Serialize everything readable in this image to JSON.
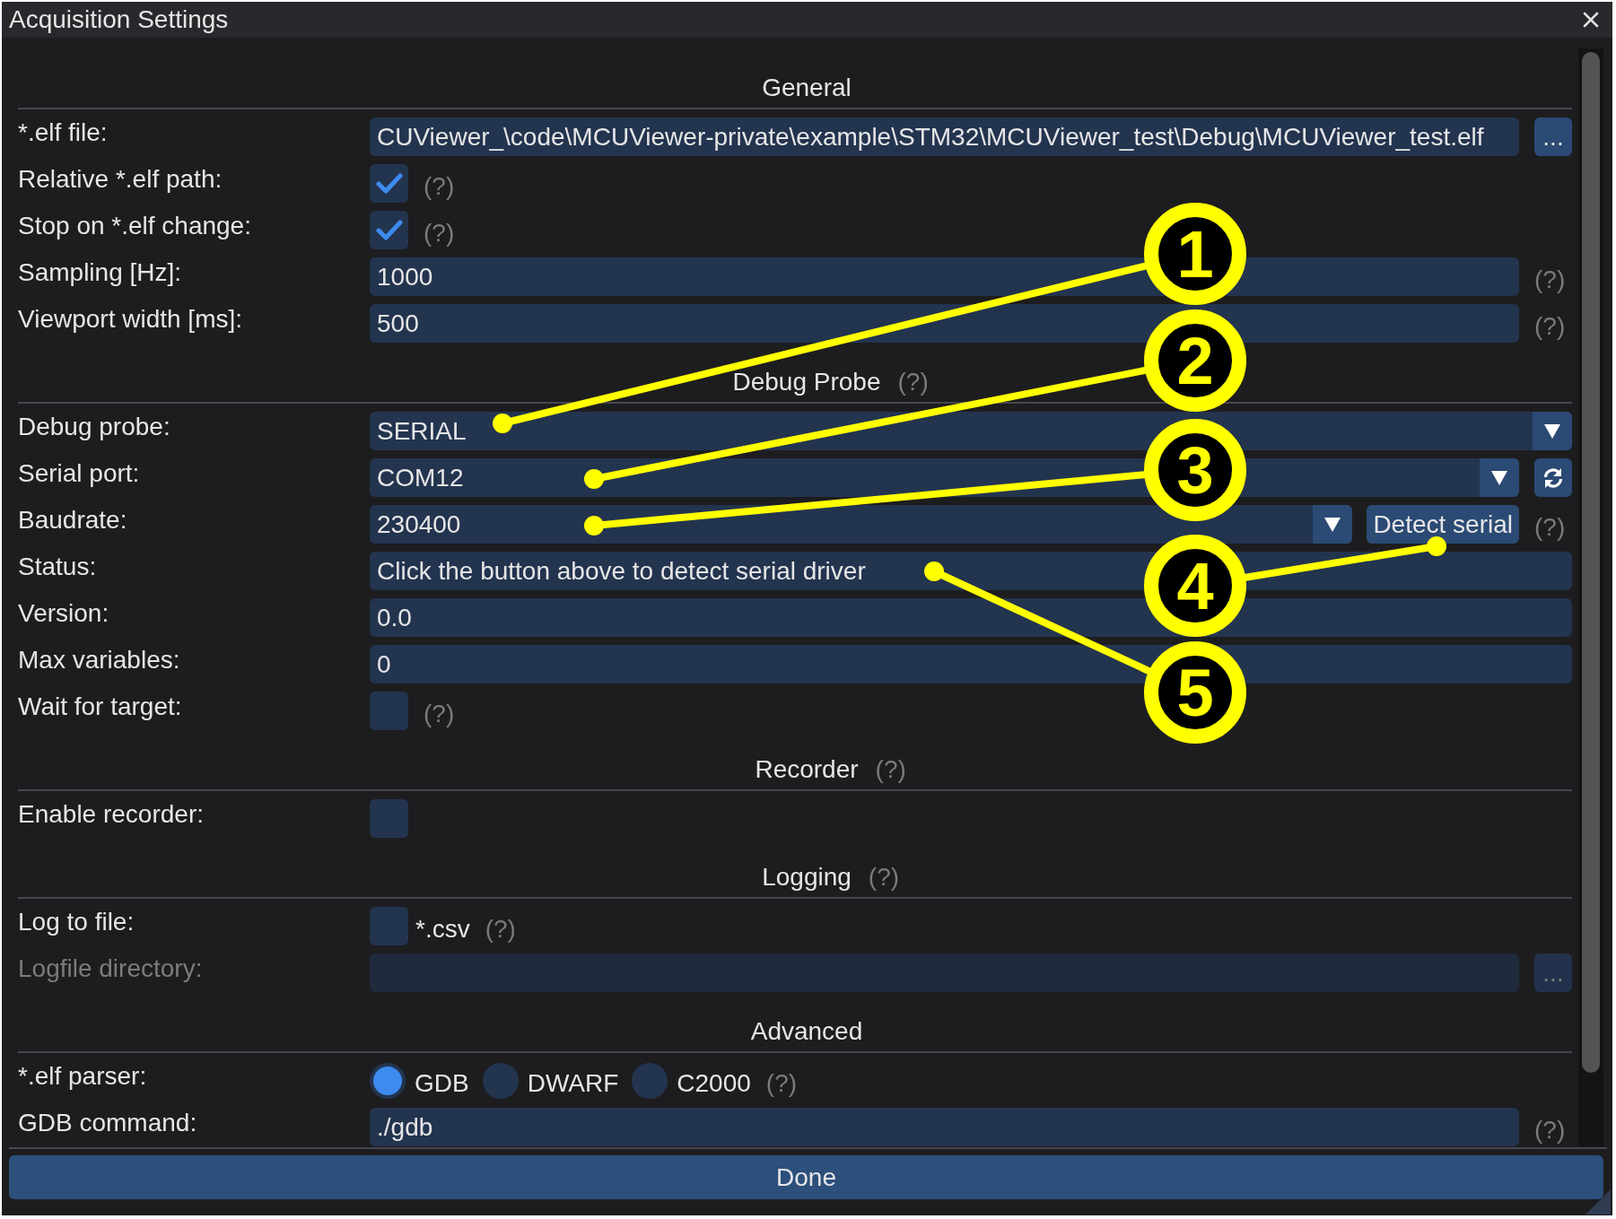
{
  "window": {
    "title": "Acquisition Settings"
  },
  "sections": [
    {
      "title": "General",
      "rows": [
        {
          "kind": "file",
          "label": "*.elf file:",
          "value": "CUViewer_\\code\\MCUViewer-private\\example\\STM32\\MCUViewer_test\\Debug\\MCUViewer_test.elf",
          "button": "...",
          "disabled": false
        },
        {
          "kind": "checkbox",
          "label": "Relative *.elf path:",
          "checked": true,
          "help": "(?)",
          "disabled": false
        },
        {
          "kind": "checkbox",
          "label": "Stop on *.elf change:",
          "checked": true,
          "help": "(?)",
          "disabled": false
        },
        {
          "kind": "input",
          "label": "Sampling [Hz]:",
          "value": "1000",
          "help": "(?)",
          "disabled": false
        },
        {
          "kind": "input",
          "label": "Viewport width [ms]:",
          "value": "500",
          "help": "(?)",
          "disabled": false
        }
      ]
    },
    {
      "title": "Debug Probe",
      "help": "(?)",
      "rows": [
        {
          "kind": "combo",
          "label": "Debug probe:",
          "value": "SERIAL",
          "disabled": false
        },
        {
          "kind": "combo",
          "label": "Serial port:",
          "value": "COM12",
          "refresh": true,
          "disabled": false
        },
        {
          "kind": "combo",
          "label": "Baudrate:",
          "value": "230400",
          "button": "Detect serial",
          "help": "(?)",
          "disabled": false
        },
        {
          "kind": "input",
          "label": "Status:",
          "value": "Click the button above to detect serial driver",
          "disabled": false
        },
        {
          "kind": "input",
          "label": "Version:",
          "value": "0.0",
          "disabled": false
        },
        {
          "kind": "input",
          "label": "Max variables:",
          "value": "0",
          "disabled": false
        },
        {
          "kind": "checkbox",
          "label": "Wait for target:",
          "checked": false,
          "help": "(?)",
          "disabled": false
        }
      ]
    },
    {
      "title": "Recorder",
      "help": "(?)",
      "rows": [
        {
          "kind": "checkbox",
          "label": "Enable recorder:",
          "checked": false,
          "disabled": false
        }
      ]
    },
    {
      "title": "Logging",
      "help": "(?)",
      "rows": [
        {
          "kind": "checkbox",
          "label": "Log to file:",
          "checked": false,
          "text": "*.csv",
          "help": "(?)",
          "disabled": false
        },
        {
          "kind": "file",
          "label": "Logfile directory:",
          "button": "...",
          "disabled": true
        }
      ]
    },
    {
      "title": "Advanced",
      "rows": [
        {
          "kind": "radio",
          "label": "*.elf parser:",
          "options": [
            {
              "label": "GDB",
              "selected": true
            },
            {
              "label": "DWARF",
              "selected": false
            },
            {
              "label": "C2000",
              "selected": false
            }
          ],
          "help": "(?)",
          "disabled": false
        },
        {
          "kind": "input",
          "label": "GDB command:",
          "value": "./gdb",
          "help": "(?)",
          "disabled": false
        }
      ]
    }
  ],
  "footer": {
    "button": "Done"
  },
  "callouts": [
    {
      "number": "1"
    },
    {
      "number": "2"
    },
    {
      "number": "3"
    },
    {
      "number": "4"
    },
    {
      "number": "5"
    }
  ]
}
